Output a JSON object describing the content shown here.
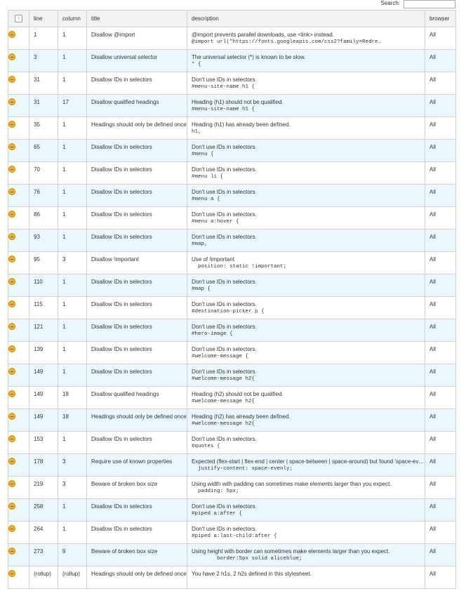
{
  "search": {
    "label": "Search:",
    "value": ""
  },
  "table": {
    "sort_icon": "↑",
    "headers": {
      "line": "line",
      "column": "column",
      "title": "title",
      "description": "description",
      "browser": "browser"
    },
    "rows": [
      {
        "line": "1",
        "column": "1",
        "title": "Disallow @import",
        "desc": "@import prevents parallel downloads, use <link> instead.",
        "code": "@import url(\"https://fonts.googleapis.com/css2?family=Redre…",
        "browser": "All"
      },
      {
        "line": "3",
        "column": "1",
        "title": "Disallow universal selector",
        "desc": "The universal selector (*) is known to be slow.",
        "code": "* {",
        "browser": "All"
      },
      {
        "line": "31",
        "column": "1",
        "title": "Disallow IDs in selectors",
        "desc": "Don't use IDs in selectors.",
        "code": "#menu-site-name h1 {",
        "browser": "All"
      },
      {
        "line": "31",
        "column": "17",
        "title": "Disallow qualified headings",
        "desc": "Heading (h1) should not be qualified.",
        "code": "#menu-site-name h1 {",
        "browser": "All"
      },
      {
        "line": "35",
        "column": "1",
        "title": "Headings should only be defined once",
        "desc": "Heading (h1) has already been defined.",
        "code": "h1,",
        "browser": "All"
      },
      {
        "line": "65",
        "column": "1",
        "title": "Disallow IDs in selectors",
        "desc": "Don't use IDs in selectors.",
        "code": "#menu {",
        "browser": "All"
      },
      {
        "line": "70",
        "column": "1",
        "title": "Disallow IDs in selectors",
        "desc": "Don't use IDs in selectors.",
        "code": "#menu li {",
        "browser": "All"
      },
      {
        "line": "76",
        "column": "1",
        "title": "Disallow IDs in selectors",
        "desc": "Don't use IDs in selectors.",
        "code": "#menu a {",
        "browser": "All"
      },
      {
        "line": "86",
        "column": "1",
        "title": "Disallow IDs in selectors",
        "desc": "Don't use IDs in selectors.",
        "code": "#menu a:hover {",
        "browser": "All"
      },
      {
        "line": "93",
        "column": "1",
        "title": "Disallow IDs in selectors",
        "desc": "Don't use IDs in selectors.",
        "code": "#map,",
        "browser": "All"
      },
      {
        "line": "95",
        "column": "3",
        "title": "Disallow !important",
        "desc": "Use of !important",
        "code": "  position: static !important;",
        "browser": "All"
      },
      {
        "line": "110",
        "column": "1",
        "title": "Disallow IDs in selectors",
        "desc": "Don't use IDs in selectors.",
        "code": "#map {",
        "browser": "All"
      },
      {
        "line": "115",
        "column": "1",
        "title": "Disallow IDs in selectors",
        "desc": "Don't use IDs in selectors.",
        "code": "#destination-picker p {",
        "browser": "All"
      },
      {
        "line": "121",
        "column": "1",
        "title": "Disallow IDs in selectors",
        "desc": "Don't use IDs in selectors.",
        "code": "#hero-image {",
        "browser": "All"
      },
      {
        "line": "139",
        "column": "1",
        "title": "Disallow IDs in selectors",
        "desc": "Don't use IDs in selectors.",
        "code": "#welcome-message {",
        "browser": "All"
      },
      {
        "line": "149",
        "column": "1",
        "title": "Disallow IDs in selectors",
        "desc": "Don't use IDs in selectors.",
        "code": "#welcome-message h2{",
        "browser": "All"
      },
      {
        "line": "149",
        "column": "18",
        "title": "Disallow qualified headings",
        "desc": "Heading (h2) should not be qualified.",
        "code": "#welcome-message h2{",
        "browser": "All"
      },
      {
        "line": "149",
        "column": "18",
        "title": "Headings should only be defined once",
        "desc": "Heading (h2) has already been defined.",
        "code": "#welcome-message h2{",
        "browser": "All"
      },
      {
        "line": "153",
        "column": "1",
        "title": "Disallow IDs in selectors",
        "desc": "Don't use IDs in selectors.",
        "code": "#quotes {",
        "browser": "All"
      },
      {
        "line": "178",
        "column": "3",
        "title": "Require use of known properties",
        "desc": "Expected (flex-start | flex-end | center | space-between | space-around) but found 'space-evenly'.",
        "code": "  justify-content: space-evenly;",
        "browser": "All"
      },
      {
        "line": "219",
        "column": "3",
        "title": "Beware of broken box size",
        "desc": "Using width with padding can sometimes make elements larger than you expect.",
        "code": "  padding: 5px;",
        "browser": "All"
      },
      {
        "line": "258",
        "column": "1",
        "title": "Disallow IDs in selectors",
        "desc": "Don't use IDs in selectors.",
        "code": "#piped a:after {",
        "browser": "All"
      },
      {
        "line": "264",
        "column": "1",
        "title": "Disallow IDs in selectors",
        "desc": "Don't use IDs in selectors.",
        "code": "#piped a:last-child:after {",
        "browser": "All"
      },
      {
        "line": "273",
        "column": "9",
        "title": "Beware of broken box size",
        "desc": "Using height with border can sometimes make elements larger than you expect.",
        "code": "        border:5px solid aliceblue;",
        "browser": "All"
      },
      {
        "line": "(rollup)",
        "column": "(rollup)",
        "title": "Headings should only be defined once",
        "desc": "You have 2 h1s, 2 h2s defined in this stylesheet.",
        "code": "",
        "browser": "All"
      }
    ]
  }
}
